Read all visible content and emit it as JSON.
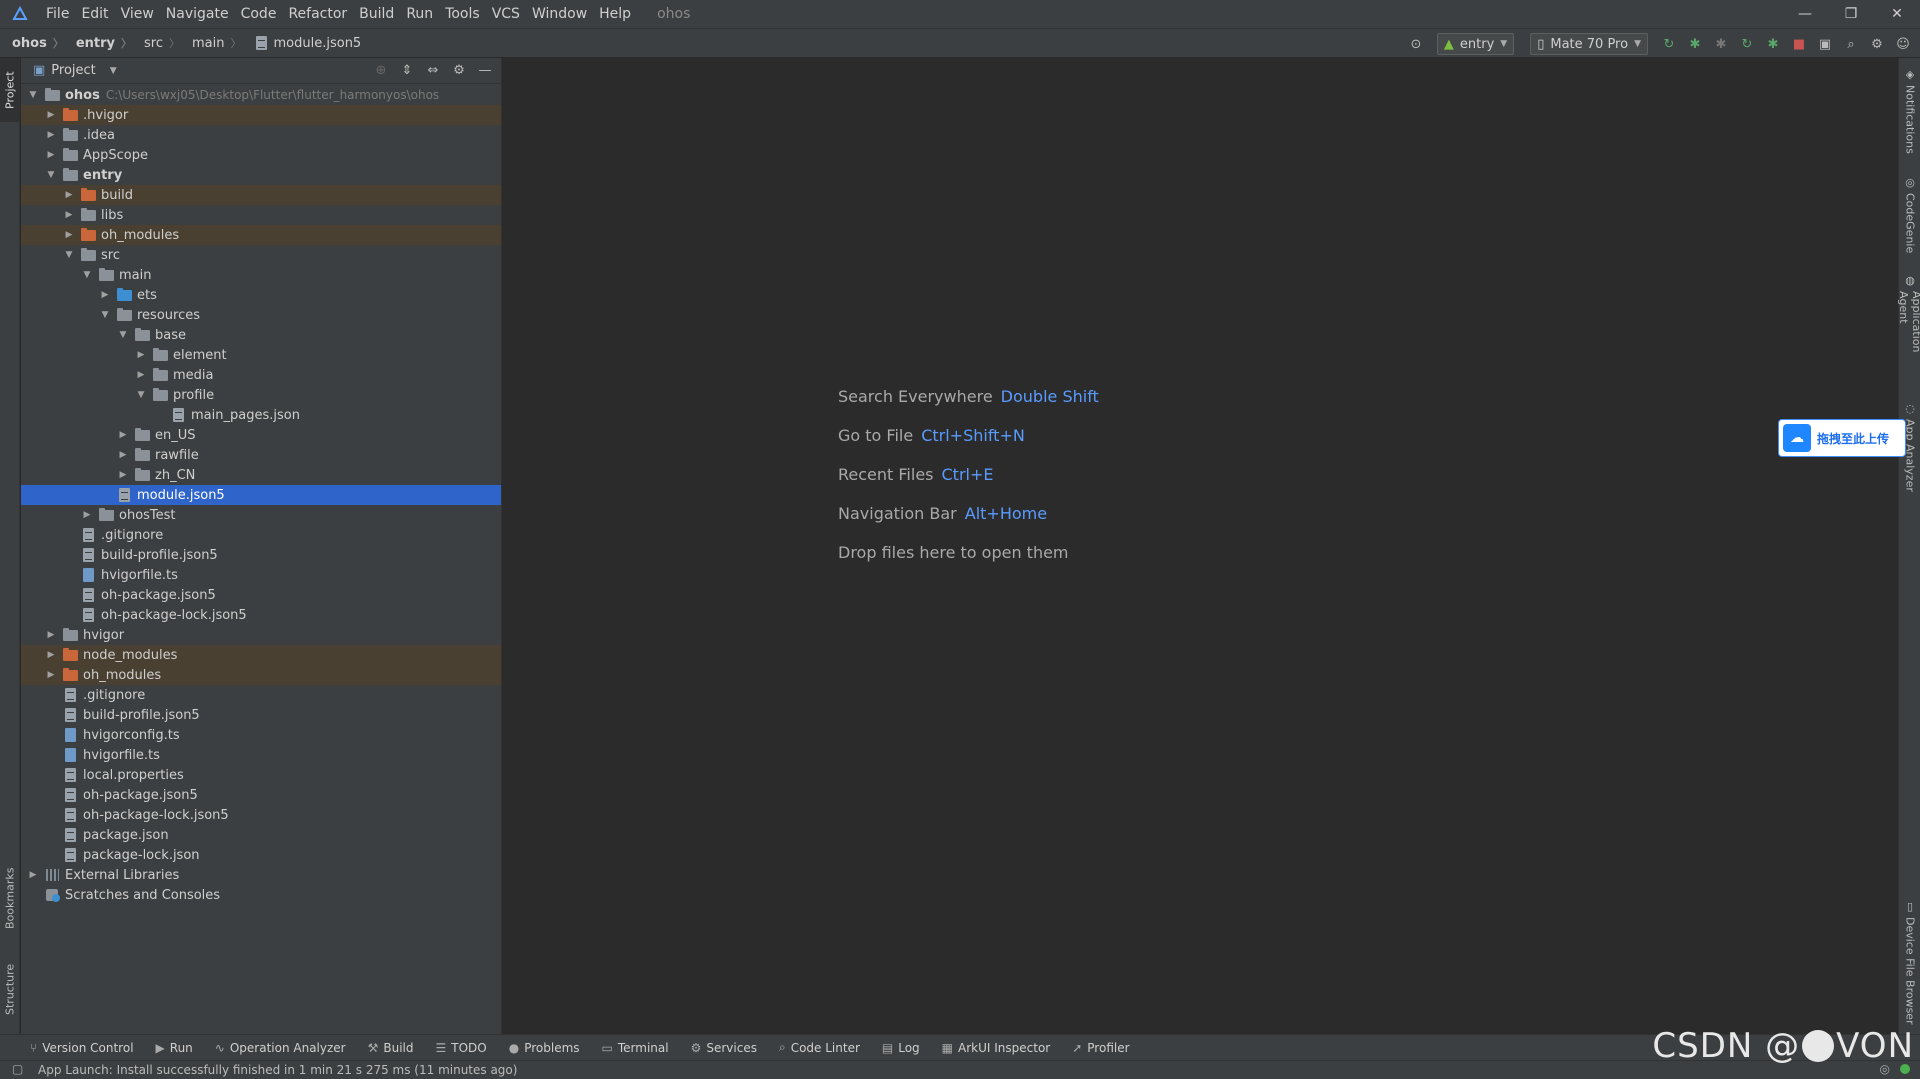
{
  "menubar": {
    "items": [
      "File",
      "Edit",
      "View",
      "Navigate",
      "Code",
      "Refactor",
      "Build",
      "Run",
      "Tools",
      "VCS",
      "Window",
      "Help"
    ],
    "title": "ohos",
    "controls": {
      "minimize": "—",
      "restore": "❐",
      "close": "✕"
    }
  },
  "breadcrumb": [
    "ohos",
    "entry",
    "src",
    "main",
    "module.json5"
  ],
  "toolbar": {
    "module_combo": "entry",
    "device_combo": "Mate 70 Pro"
  },
  "left_strip": {
    "project": "Project",
    "bookmarks": "Bookmarks",
    "structure": "Structure"
  },
  "right_strip": {
    "notifications": "Notifications",
    "codegenie": "CodeGenie",
    "app_agent": "Application Agent",
    "app_analyzer": "App Analyzer",
    "device_file_browser": "Device File Browser"
  },
  "project_panel": {
    "title": "Project",
    "tree": [
      {
        "label": "ohos",
        "depth": 0,
        "expand": "open",
        "icon": "module",
        "bold": true,
        "path": "C:\\Users\\wxj05\\Desktop\\Flutter\\flutter_harmonyos\\ohos"
      },
      {
        "label": ".hvigor",
        "depth": 1,
        "expand": "closed",
        "icon": "folder-orange",
        "excluded": true
      },
      {
        "label": ".idea",
        "depth": 1,
        "expand": "closed",
        "icon": "folder"
      },
      {
        "label": "AppScope",
        "depth": 1,
        "expand": "closed",
        "icon": "folder"
      },
      {
        "label": "entry",
        "depth": 1,
        "expand": "open",
        "icon": "module",
        "bold": true
      },
      {
        "label": "build",
        "depth": 2,
        "expand": "closed",
        "icon": "folder-orange",
        "excluded": true
      },
      {
        "label": "libs",
        "depth": 2,
        "expand": "closed",
        "icon": "folder"
      },
      {
        "label": "oh_modules",
        "depth": 2,
        "expand": "closed",
        "icon": "folder-orange",
        "excluded": true
      },
      {
        "label": "src",
        "depth": 2,
        "expand": "open",
        "icon": "folder"
      },
      {
        "label": "main",
        "depth": 3,
        "expand": "open",
        "icon": "folder"
      },
      {
        "label": "ets",
        "depth": 4,
        "expand": "closed",
        "icon": "folder-blue"
      },
      {
        "label": "resources",
        "depth": 4,
        "expand": "open",
        "icon": "folder"
      },
      {
        "label": "base",
        "depth": 5,
        "expand": "open",
        "icon": "folder"
      },
      {
        "label": "element",
        "depth": 6,
        "expand": "closed",
        "icon": "folder"
      },
      {
        "label": "media",
        "depth": 6,
        "expand": "closed",
        "icon": "folder"
      },
      {
        "label": "profile",
        "depth": 6,
        "expand": "open",
        "icon": "folder"
      },
      {
        "label": "main_pages.json",
        "depth": 7,
        "expand": "none",
        "icon": "file"
      },
      {
        "label": "en_US",
        "depth": 5,
        "expand": "closed",
        "icon": "folder"
      },
      {
        "label": "rawfile",
        "depth": 5,
        "expand": "closed",
        "icon": "folder"
      },
      {
        "label": "zh_CN",
        "depth": 5,
        "expand": "closed",
        "icon": "folder"
      },
      {
        "label": "module.json5",
        "depth": 4,
        "expand": "none",
        "icon": "file",
        "selected": true
      },
      {
        "label": "ohosTest",
        "depth": 3,
        "expand": "closed",
        "icon": "folder"
      },
      {
        "label": ".gitignore",
        "depth": 2,
        "expand": "none",
        "icon": "file"
      },
      {
        "label": "build-profile.json5",
        "depth": 2,
        "expand": "none",
        "icon": "file"
      },
      {
        "label": "hvigorfile.ts",
        "depth": 2,
        "expand": "none",
        "icon": "ts"
      },
      {
        "label": "oh-package.json5",
        "depth": 2,
        "expand": "none",
        "icon": "file"
      },
      {
        "label": "oh-package-lock.json5",
        "depth": 2,
        "expand": "none",
        "icon": "file"
      },
      {
        "label": "hvigor",
        "depth": 1,
        "expand": "closed",
        "icon": "folder"
      },
      {
        "label": "node_modules",
        "depth": 1,
        "expand": "closed",
        "icon": "folder-orange",
        "excluded": true
      },
      {
        "label": "oh_modules",
        "depth": 1,
        "expand": "closed",
        "icon": "folder-orange",
        "excluded": true
      },
      {
        "label": ".gitignore",
        "depth": 1,
        "expand": "none",
        "icon": "file"
      },
      {
        "label": "build-profile.json5",
        "depth": 1,
        "expand": "none",
        "icon": "file"
      },
      {
        "label": "hvigorconfig.ts",
        "depth": 1,
        "expand": "none",
        "icon": "ts"
      },
      {
        "label": "hvigorfile.ts",
        "depth": 1,
        "expand": "none",
        "icon": "ts"
      },
      {
        "label": "local.properties",
        "depth": 1,
        "expand": "none",
        "icon": "file"
      },
      {
        "label": "oh-package.json5",
        "depth": 1,
        "expand": "none",
        "icon": "file"
      },
      {
        "label": "oh-package-lock.json5",
        "depth": 1,
        "expand": "none",
        "icon": "file"
      },
      {
        "label": "package.json",
        "depth": 1,
        "expand": "none",
        "icon": "file"
      },
      {
        "label": "package-lock.json",
        "depth": 1,
        "expand": "none",
        "icon": "file"
      },
      {
        "label": "External Libraries",
        "depth": 0,
        "expand": "closed",
        "icon": "lib"
      },
      {
        "label": "Scratches and Consoles",
        "depth": 0,
        "expand": "none",
        "icon": "scratch"
      }
    ]
  },
  "welcome": [
    {
      "label": "Search Everywhere",
      "key": "Double Shift"
    },
    {
      "label": "Go to File",
      "key": "Ctrl+Shift+N"
    },
    {
      "label": "Recent Files",
      "key": "Ctrl+E"
    },
    {
      "label": "Navigation Bar",
      "key": "Alt+Home"
    },
    {
      "label": "Drop files here to open them",
      "key": ""
    }
  ],
  "upload_widget": {
    "label": "拖拽至此上传"
  },
  "bottom_tabs": [
    {
      "glyph": "⑂",
      "label": "Version Control"
    },
    {
      "glyph": "▶",
      "label": "Run"
    },
    {
      "glyph": "∿",
      "label": "Operation Analyzer"
    },
    {
      "glyph": "⚒",
      "label": "Build"
    },
    {
      "glyph": "☰",
      "label": "TODO"
    },
    {
      "glyph": "●",
      "label": "Problems"
    },
    {
      "glyph": "▭",
      "label": "Terminal"
    },
    {
      "glyph": "⚙",
      "label": "Services"
    },
    {
      "glyph": "⌕",
      "label": "Code Linter"
    },
    {
      "glyph": "▤",
      "label": "Log"
    },
    {
      "glyph": "▦",
      "label": "ArkUI Inspector"
    },
    {
      "glyph": "➚",
      "label": "Profiler"
    }
  ],
  "status": {
    "message": "App Launch: Install successfully finished in 1 min 21 s 275 ms (11 minutes ago)"
  },
  "watermark": {
    "left": "CSDN @",
    "right": "VON"
  },
  "colors": {
    "accent": "#2f65ca",
    "key_text": "#5a9bff",
    "excluded_bg": "#4a4032"
  }
}
